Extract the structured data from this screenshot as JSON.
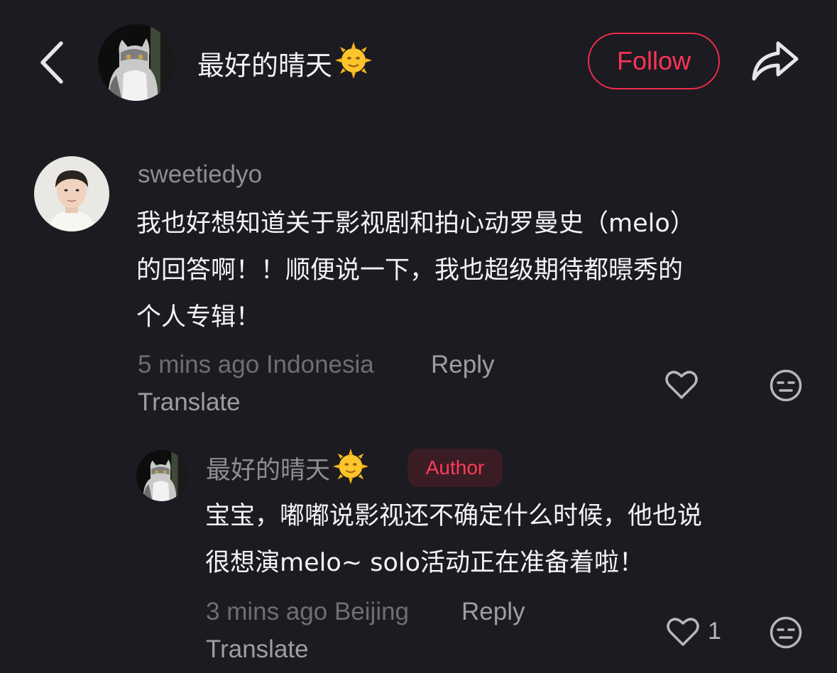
{
  "header": {
    "author_name": "最好的晴天",
    "name_emoji": "🌞",
    "follow_label": "Follow"
  },
  "comment": {
    "username": "sweetiedyo",
    "lines": [
      "我也好想知道关于影视剧和拍心动罗曼史（melo）",
      "的回答啊！！顺便说一下，我也超级期待都暻秀的",
      "个人专辑！"
    ],
    "time": "5 mins ago",
    "location": "Indonesia",
    "reply_label": "Reply",
    "translate_label": "Translate"
  },
  "reply": {
    "username": "最好的晴天",
    "name_emoji": "🌞",
    "badge": "Author",
    "lines": [
      "宝宝，嘟嘟说影视还不确定什么时候，他也说",
      "很想演melo~ solo活动正在准备着啦！"
    ],
    "time": "3 mins ago",
    "location": "Beijing",
    "reply_label": "Reply",
    "translate_label": "Translate",
    "like_count": "1"
  },
  "colors": {
    "background": "#1c1b21",
    "accent": "#ee2c4a",
    "muted_text": "#8e8d93"
  },
  "icons": [
    "back-chevron-icon",
    "share-icon",
    "heart-icon",
    "meh-face-icon",
    "sun-emoji"
  ]
}
